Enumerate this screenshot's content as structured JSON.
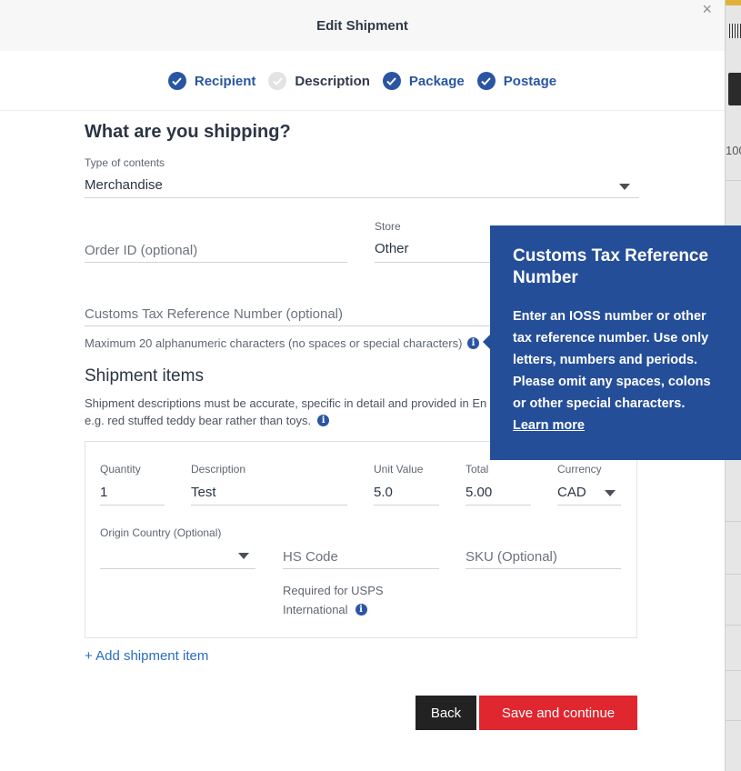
{
  "modal": {
    "title": "Edit Shipment",
    "close_glyph": "×"
  },
  "steps": [
    {
      "label": "Recipient",
      "done": true
    },
    {
      "label": "Description",
      "done": false
    },
    {
      "label": "Package",
      "done": true
    },
    {
      "label": "Postage",
      "done": true
    }
  ],
  "section": {
    "heading": "What are you shipping?"
  },
  "contents": {
    "label": "Type of contents",
    "value": "Merchandise"
  },
  "order": {
    "placeholder": "Order ID (optional)"
  },
  "store": {
    "label": "Store",
    "value": "Other"
  },
  "customs": {
    "placeholder": "Customs Tax Reference Number (optional)",
    "hint": "Maximum 20 alphanumeric characters (no spaces or special characters)"
  },
  "items_section": {
    "heading": "Shipment items",
    "note_line1": "Shipment descriptions must be accurate, specific in detail and provided in En",
    "note_line2": "e.g. red stuffed teddy bear rather than toys."
  },
  "item": {
    "quantity_label": "Quantity",
    "quantity": "1",
    "description_label": "Description",
    "description": "Test",
    "unit_value_label": "Unit Value",
    "unit_value": "5.0",
    "total_label": "Total",
    "total": "5.00",
    "currency_label": "Currency",
    "currency": "CAD",
    "origin_label": "Origin Country (Optional)",
    "hs_placeholder": "HS Code",
    "hs_note_line1": "Required for USPS",
    "hs_note_line2": "International",
    "sku_placeholder": "SKU (Optional)"
  },
  "add_item": "+ Add shipment item",
  "buttons": {
    "back": "Back",
    "save": "Save and continue"
  },
  "tooltip": {
    "title": "Customs Tax Reference Number",
    "body": "Enter an IOSS number or other tax reference number. Use only letters, numbers and periods. Please omit any spaces, colons or other special characters.",
    "link": "Learn more"
  },
  "background": {
    "number_fragment": "100"
  },
  "icons": {
    "info": "info-icon",
    "check": "check-circle-icon",
    "caret": "caret-down-icon"
  },
  "colors": {
    "accent": "#2a55a3",
    "tooltip_bg": "#254e99",
    "save": "#e0262f",
    "back": "#222222"
  }
}
